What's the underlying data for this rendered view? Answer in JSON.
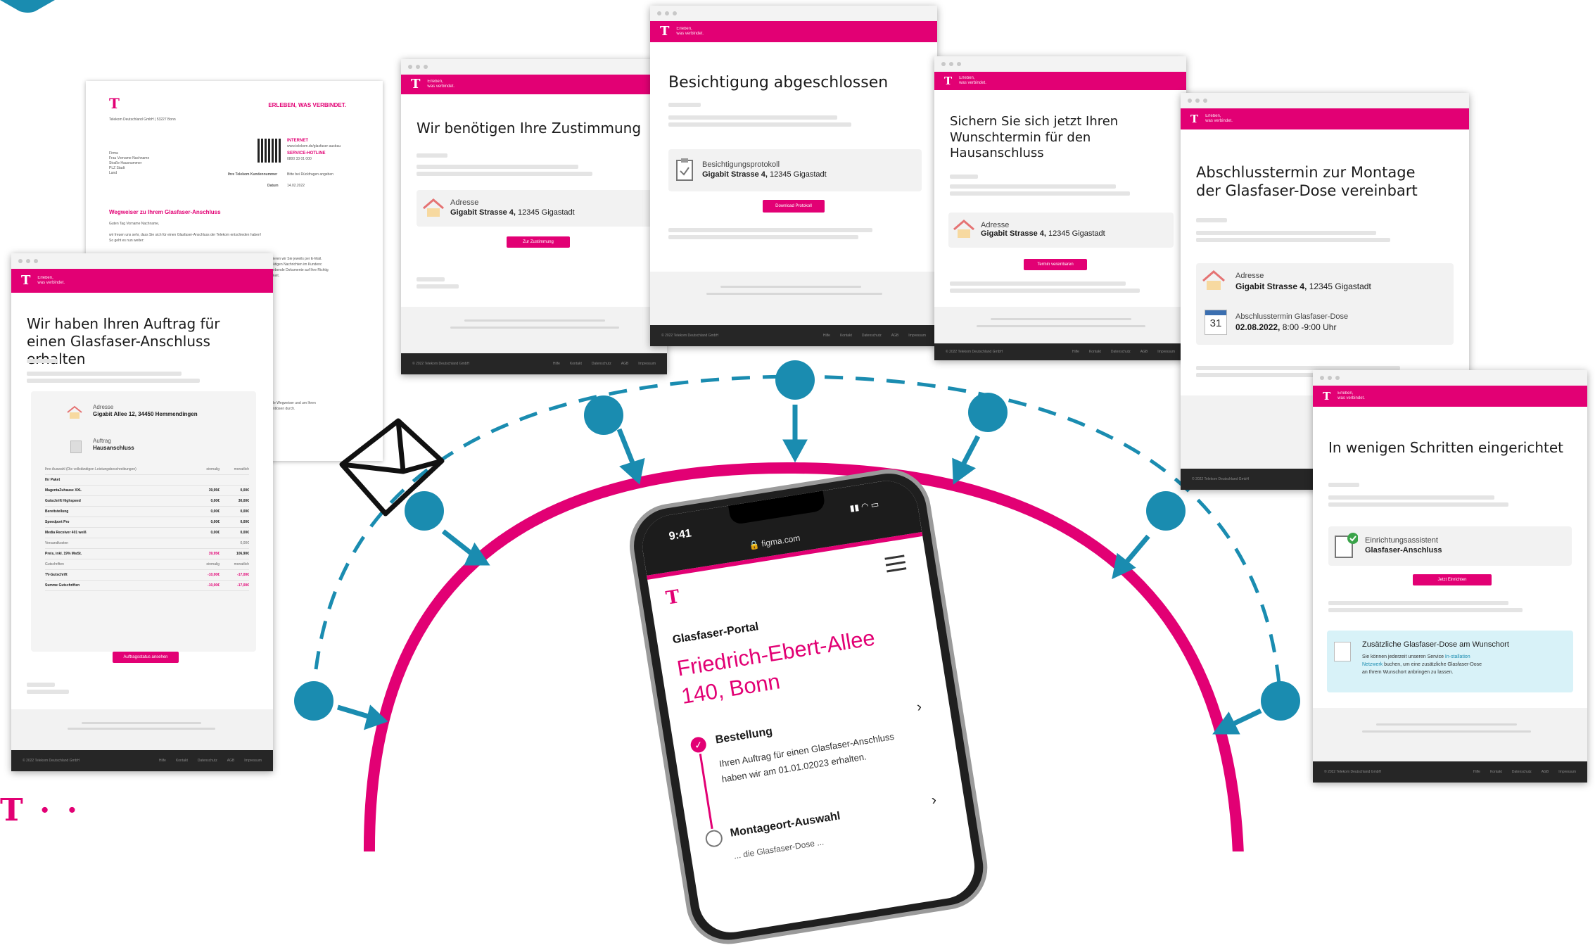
{
  "letter": {
    "tlogo": "T",
    "slogan": "ERLEBEN, WAS VERBINDET.",
    "company_line": "Telekom Deutschland GmbH | 53227 Bonn",
    "addr": "Firma\nFrau Vorname Nachname\nStraße Hausnummer\nPLZ Stadt\nLand",
    "internet_label": "INTERNET",
    "internet_url": "www.telekom.de/glasfaser-ausbau",
    "hotline_label": "SERVICE-HOTLINE",
    "hotline_num": "0800 33 01 000",
    "customer_no_label": "Ihre Telekom Kundennummer",
    "customer_no_val": "Bitte bei Rückfragen angeben",
    "date_label": "Datum",
    "date_val": "14.02.2022",
    "headline": "Wegweiser zu Ihrem Glasfaser-Anschluss",
    "greeting": "Guten Tag Vorname Nachname,",
    "body1": "wir freuen uns sehr, dass Sie sich für einen Glasfaser-Anschluss der Telekom entschieden haben!",
    "body2": "So geht es nun weiter:",
    "side1": "ieren wir Sie jeweils per E-Mail.",
    "side2": "ätigen Nachrichten im Kundenc",
    "side3": "ebende Dokumente auf Ihre Richtig",
    "side4": "keit.",
    "side5": "le Wegweiser und um Ihren",
    "side6": "ntlosen durch."
  },
  "win1": {
    "tagline": "Erleben,\nwas verbindet.",
    "title": "Wir haben Ihren Auftrag für einen Glasfaser-Anschluss erhalten",
    "addr_label": "Adresse",
    "addr_val": "Gigabit Allee 12, 34450 Hemmendingen",
    "order_label": "Auftrag",
    "order_val": "Hausanschluss",
    "table_header": [
      "Ihre Auswahl (Die vollständigen Leistungsbeschreibungen)",
      "einmalig",
      "monatlich"
    ],
    "rows": [
      [
        "Ihr Paket",
        "",
        ""
      ],
      [
        "MagentaZuhause XXL",
        "39,95€",
        "0,00€"
      ],
      [
        "Gutschrift Highspeed",
        "0,00€",
        "30,00€"
      ],
      [
        "Bereitstellung",
        "0,00€",
        "0,00€"
      ],
      [
        "Speedport Pro",
        "0,00€",
        "0,00€"
      ],
      [
        "Media Receiver 401 weiß",
        "0,00€",
        "0,00€"
      ],
      [
        "Versandkosten",
        "",
        "0,00€"
      ],
      [
        "Preis, inkl. 19% MwSt.",
        "39,95€",
        "106,90€"
      ],
      [
        "Gutschriften",
        "einmalig",
        "monatlich"
      ],
      [
        "TV-Gutschrift",
        "-10,00€",
        "-17,00€"
      ],
      [
        "Summe Gutschriften",
        "-10,00€",
        "-17,00€"
      ]
    ],
    "button": "Auftragsstatus ansehen",
    "footer_left": "© 2022 Telekom Deutschland GmbH",
    "footer_links": [
      "Hilfe",
      "Kontakt",
      "Datenschutz",
      "AGB",
      "Impressum"
    ]
  },
  "win2": {
    "tagline": "Erleben,\nwas verbindet.",
    "title": "Wir benötigen Ihre Zustimmung",
    "addr_label": "Adresse",
    "addr_val_bold": "Gigabit Strasse 4,",
    "addr_val_rest": " 12345 Gigastadt",
    "button": "Zur Zustimmung",
    "footer_left": "© 2022 Telekom Deutschland GmbH",
    "footer_links": [
      "Hilfe",
      "Kontakt",
      "Datenschutz",
      "AGB",
      "Impressum"
    ]
  },
  "win3": {
    "tagline": "Erleben,\nwas verbindet.",
    "title": "Besichtigung abgeschlossen",
    "proto_label": "Besichtigungsprotokoll",
    "proto_val_bold": "Gigabit Strasse 4,",
    "proto_val_rest": " 12345 Gigastadt",
    "button": "Download Protokoll",
    "footer_left": "© 2022 Telekom Deutschland GmbH",
    "footer_links": [
      "Hilfe",
      "Kontakt",
      "Datenschutz",
      "AGB",
      "Impressum"
    ]
  },
  "win4": {
    "tagline": "Erleben,\nwas verbindet.",
    "title": "Sichern Sie sich jetzt Ihren Wunschtermin für den Hausanschluss",
    "addr_label": "Adresse",
    "addr_val_bold": "Gigabit Strasse 4,",
    "addr_val_rest": " 12345 Gigastadt",
    "button": "Termin vereinbaren",
    "footer_left": "© 2022 Telekom Deutschland GmbH",
    "footer_links": [
      "Hilfe",
      "Kontakt",
      "Datenschutz",
      "AGB",
      "Impressum"
    ]
  },
  "win5": {
    "tagline": "Erleben,\nwas verbindet.",
    "title": "Abschlusstermin zur Montage der Glasfaser-Dose vereinbart",
    "addr_label": "Adresse",
    "addr_val_bold": "Gigabit Strasse 4,",
    "addr_val_rest": " 12345 Gigastadt",
    "cal_day": "31",
    "date_label": "Abschlusstermin Glasfaser-Dose",
    "date_val_bold": "02.08.2022,",
    "date_val_rest": " 8:00 -9:00 Uhr",
    "footer_left": "© 2022 Telekom Deutschland GmbH"
  },
  "win6": {
    "tagline": "Erleben,\nwas verbindet.",
    "title": "In wenigen Schritten eingerichtet",
    "assist_label": "Einrichtungsassistent",
    "assist_val": "Glasfaser-Anschluss",
    "button": "Jetzt Einrichten",
    "info_title": "Zusätzliche Glasfaser-Dose am Wunschort",
    "info_l1": "Sie können jederzeit unseren Service ",
    "info_link1": "In-stallation",
    "info_l2a": "Netzwerk",
    "info_l2": " buchen, um eine zusätzliche Glasfaser-Dose",
    "info_l3": "an Ihrem Wunschort anbringen zu lassen.",
    "footer_left": "© 2022 Telekom Deutschland GmbH",
    "footer_links": [
      "Hilfe",
      "Kontakt",
      "Datenschutz",
      "AGB",
      "Impressum"
    ]
  },
  "phone": {
    "time": "9:41",
    "url": "figma.com",
    "portal": "Glasfaser-Portal",
    "address": "Friedrich-Ebert-Allee\n140, Bonn",
    "step1": "Bestellung",
    "step1_text": "Ihren Auftrag für einen Glasfaser-Anschluss\nhaben wir am 01.01.02023 erhalten.",
    "step2": "Montageort-Auswahl",
    "step2_text": "... die Glasfaser-Dose ..."
  },
  "corner_logo": "T · ·",
  "colors": {
    "magenta": "#e20074",
    "node": "#1a8cb0",
    "dark": "#262626"
  }
}
